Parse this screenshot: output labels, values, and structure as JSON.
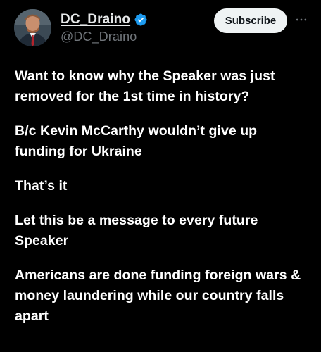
{
  "author": {
    "display_name": "DC_Draino",
    "handle": "@DC_Draino",
    "verified": true,
    "verified_icon": "verified-badge-icon",
    "verified_color": "#1d9bf0"
  },
  "actions": {
    "subscribe_label": "Subscribe",
    "more_icon": "more-horizontal-icon"
  },
  "post": {
    "paragraphs": [
      "Want to know why the Speaker was just removed for the 1st time in history?",
      "B/c Kevin McCarthy wouldn’t give up funding for Ukraine",
      "That’s it",
      "Let this be a message to every future Speaker",
      "Americans are done funding foreign wars & money laundering while our country falls apart"
    ]
  },
  "colors": {
    "background": "#000000",
    "text": "#ffffff",
    "secondary_text": "#71767b",
    "button_bg": "#eff3f4",
    "button_text": "#0f1419"
  }
}
